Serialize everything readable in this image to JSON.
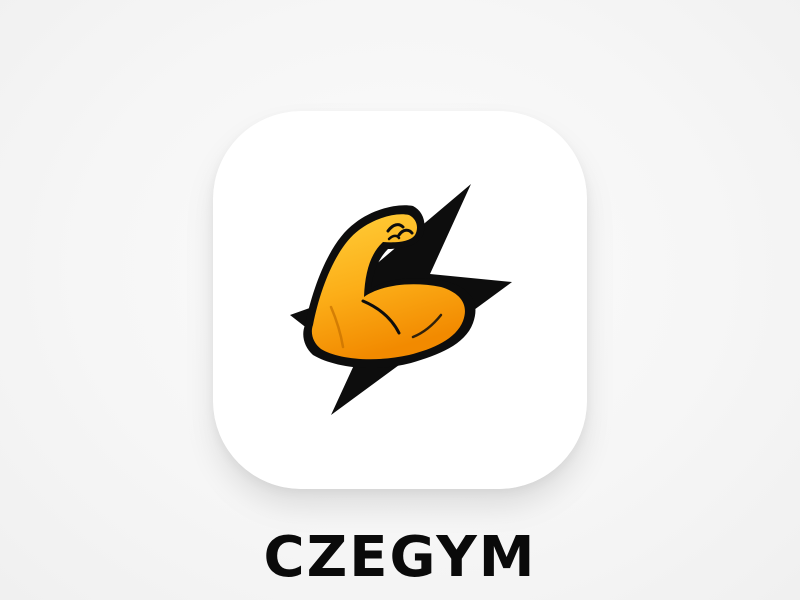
{
  "app": {
    "name": "CZEGYM"
  },
  "icon": {
    "logo_icons": [
      "lightning-bolt-icon",
      "flexed-arm-icon"
    ],
    "colors": {
      "tile_background": "#ffffff",
      "bolt": "#0d0d0d",
      "arm_light": "#ffcc33",
      "arm_dark": "#f59200",
      "outline": "#0d0d0d",
      "page_background": "#f5f5f5"
    }
  }
}
